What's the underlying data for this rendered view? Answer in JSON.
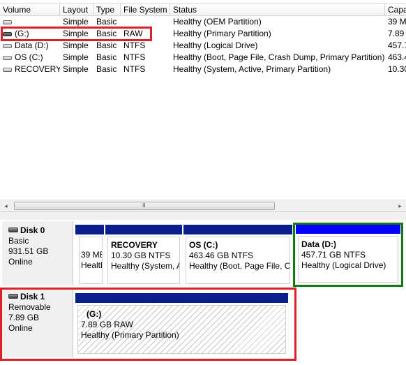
{
  "volume_list": {
    "columns": [
      "Volume",
      "Layout",
      "Type",
      "File System",
      "Status",
      "Capa"
    ],
    "rows": [
      {
        "volume": "",
        "layout": "Simple",
        "type": "Basic",
        "fs": "",
        "status": "Healthy (OEM Partition)",
        "capacity": "39 M",
        "icon": "drive-icon"
      },
      {
        "volume": "(G:)",
        "layout": "Simple",
        "type": "Basic",
        "fs": "RAW",
        "status": "Healthy (Primary Partition)",
        "capacity": "7.89",
        "icon": "removable-drive-icon"
      },
      {
        "volume": "Data (D:)",
        "layout": "Simple",
        "type": "Basic",
        "fs": "NTFS",
        "status": "Healthy (Logical Drive)",
        "capacity": "457.7",
        "icon": "drive-icon"
      },
      {
        "volume": "OS (C:)",
        "layout": "Simple",
        "type": "Basic",
        "fs": "NTFS",
        "status": "Healthy (Boot, Page File, Crash Dump, Primary Partition)",
        "capacity": "463.4",
        "icon": "drive-icon"
      },
      {
        "volume": "RECOVERY",
        "layout": "Simple",
        "type": "Basic",
        "fs": "NTFS",
        "status": "Healthy (System, Active, Primary Partition)",
        "capacity": "10.30",
        "icon": "drive-icon"
      }
    ]
  },
  "scrollbar": {
    "left_arrow": "◂",
    "right_arrow": "▸",
    "grip": "III"
  },
  "disks": [
    {
      "name": "Disk 0",
      "type": "Basic",
      "size": "931.51 GB",
      "state": "Online",
      "partitions": [
        {
          "title": "",
          "line1": "39 MB",
          "line2": "Health"
        },
        {
          "title": "RECOVERY",
          "line1": "10.30 GB NTFS",
          "line2": "Healthy (System, A"
        },
        {
          "title": "OS  (C:)",
          "line1": "463.46 GB NTFS",
          "line2": "Healthy (Boot, Page File, C"
        },
        {
          "title": "Data  (D:)",
          "line1": "457.71 GB NTFS",
          "line2": "Healthy (Logical Drive)"
        }
      ]
    },
    {
      "name": "Disk 1",
      "type": "Removable",
      "size": "7.89 GB",
      "state": "Online",
      "partitions": [
        {
          "title": "(G:)",
          "line1": "7.89 GB RAW",
          "line2": "Healthy (Primary Partition)"
        }
      ]
    }
  ],
  "colors": {
    "primary_bar": "#0a1e8c",
    "logical_bar": "#0000ff",
    "highlight_red": "#d9212b",
    "highlight_green": "#0f7a0f"
  }
}
